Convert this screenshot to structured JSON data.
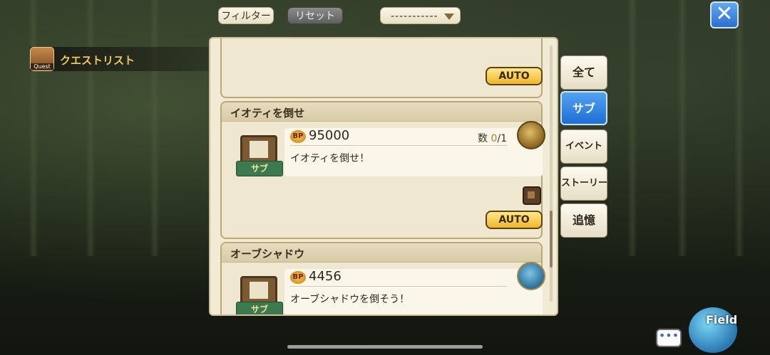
{
  "topbar": {
    "filter_label": "フィルター",
    "reset_label": "リセット",
    "dropdown_value": "-----------",
    "close_icon": "close-icon"
  },
  "quest_list": {
    "title": "クエストリスト",
    "icon_text": "Quest"
  },
  "cards": [
    {
      "auto_label": "AUTO"
    },
    {
      "title": "イオティを倒せ",
      "bp_label": "BP",
      "bp_value": "95000",
      "count_label": "数",
      "count_current": "0",
      "count_total": "/1",
      "description": "イオティを倒せ！",
      "badge_label": "サブ",
      "auto_label": "AUTO"
    },
    {
      "title": "オーブシャドウ",
      "bp_label": "BP",
      "bp_value": "4456",
      "description": "オーブシャドウを倒そう！",
      "badge_label": "サブ"
    }
  ],
  "tabs": [
    {
      "label": "全て"
    },
    {
      "label": "サブ",
      "active": true
    },
    {
      "label": "イベント"
    },
    {
      "label": "ストーリー"
    },
    {
      "label": "追憶"
    }
  ],
  "bottom": {
    "field_label": "Field",
    "chat_icon": "chat-bubble-icon"
  },
  "colors": {
    "accent_blue": "#2f7fe0",
    "auto_gold": "#f0b62b",
    "panel_bg": "#f1ead4",
    "bp_orange": "#d08a1f"
  }
}
